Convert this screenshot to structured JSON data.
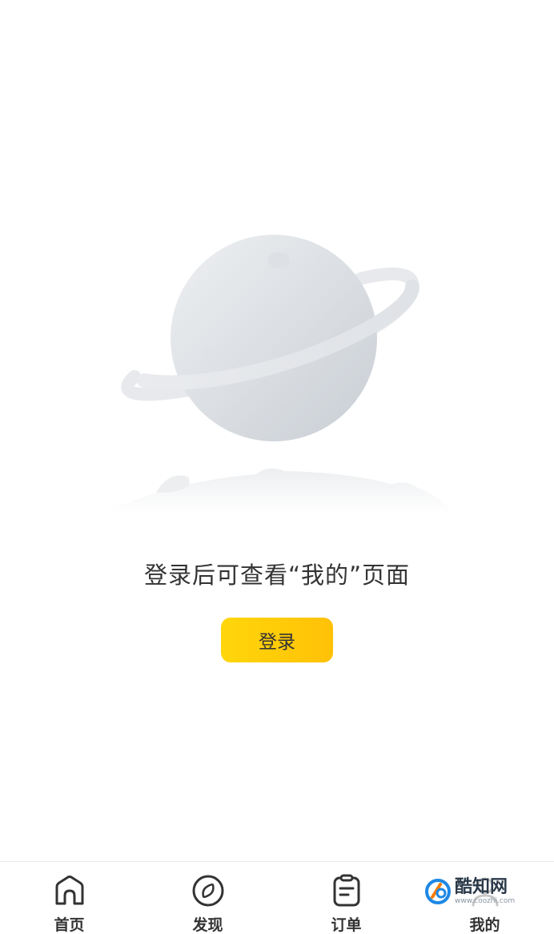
{
  "empty_state": {
    "message": "登录后可查看“我的”页面",
    "login_button": "登录"
  },
  "tabbar": {
    "items": [
      {
        "label": "首页",
        "icon": "home-icon"
      },
      {
        "label": "发现",
        "icon": "compass-icon"
      },
      {
        "label": "订单",
        "icon": "clipboard-icon"
      },
      {
        "label": "我的",
        "icon": "user-icon"
      }
    ]
  },
  "watermark": {
    "name": "酷知网",
    "url": "www.coozhi.com"
  },
  "colors": {
    "accent": "#ffc107",
    "text": "#333333"
  }
}
